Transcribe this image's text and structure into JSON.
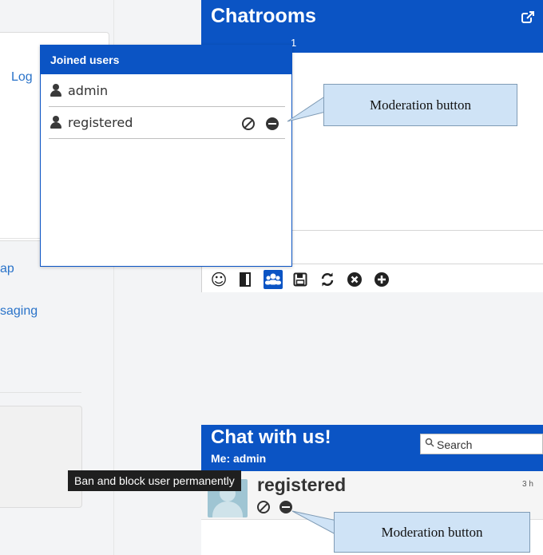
{
  "left_page": {
    "links": [
      "Log",
      "ap",
      "saging"
    ]
  },
  "chatrooms": {
    "title": "Chatrooms",
    "popout_icon": "external-link-icon",
    "room_tab": "1",
    "toolbar_icons": [
      "smiley-icon",
      "exit-door-icon",
      "users-icon",
      "save-icon",
      "refresh-icon",
      "close-circle-icon",
      "plus-circle-icon"
    ]
  },
  "joined_users": {
    "title": "Joined users",
    "users": [
      {
        "name": "admin",
        "moderation": false
      },
      {
        "name": "registered",
        "moderation": true
      }
    ]
  },
  "callouts": {
    "top": "Moderation button",
    "bottom": "Moderation button"
  },
  "chat_with_us": {
    "title": "Chat with us!",
    "me_label": "Me: admin",
    "search_placeholder": "Search",
    "entry": {
      "name": "registered",
      "time": "3 h"
    }
  },
  "tooltip": "Ban and block user permanently",
  "colors": {
    "brand_blue": "#0b54c4",
    "callout_fill": "#cfe3f6",
    "link_blue": "#2a73c9"
  }
}
